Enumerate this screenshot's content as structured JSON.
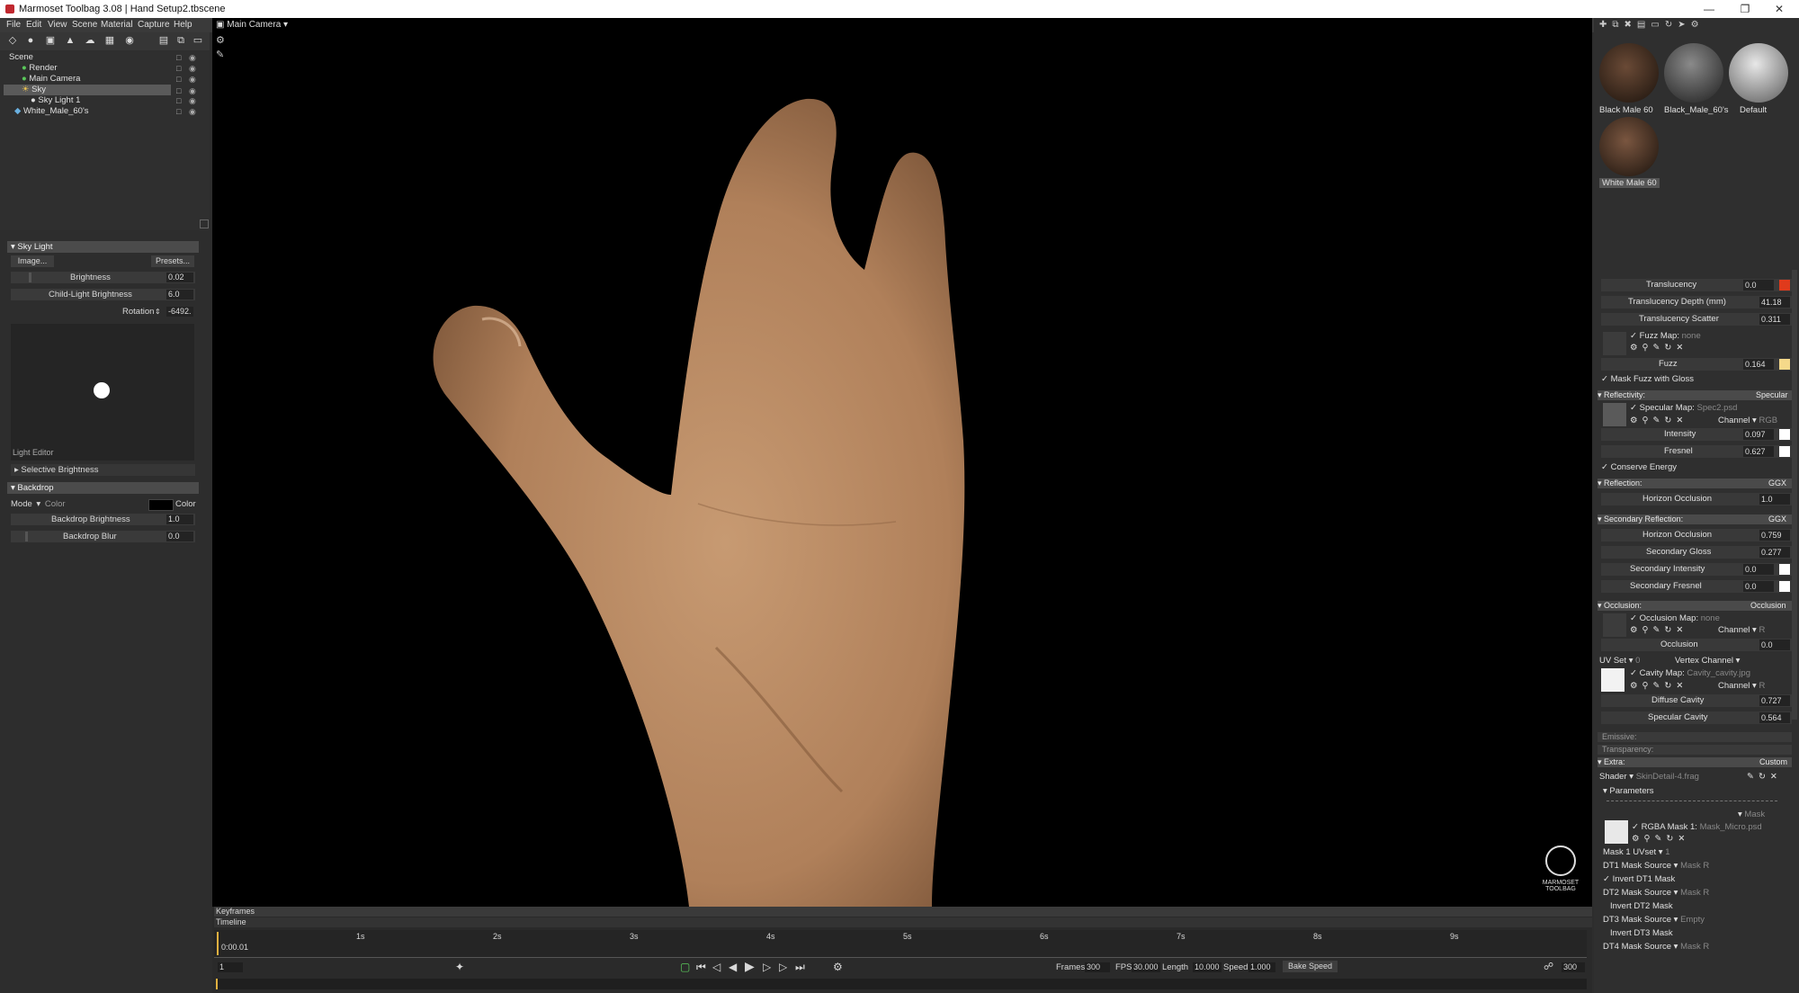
{
  "window": {
    "title": "Marmoset Toolbag 3.08  |  Hand Setup2.tbscene"
  },
  "menu": [
    "File",
    "Edit",
    "View",
    "Scene",
    "Material",
    "Capture",
    "Help"
  ],
  "outliner": {
    "items": [
      {
        "label": "Scene",
        "indent": 0
      },
      {
        "label": "Render",
        "indent": 1
      },
      {
        "label": "Main Camera",
        "indent": 1
      },
      {
        "label": "Sky",
        "indent": 1,
        "selected": true
      },
      {
        "label": "Sky Light 1",
        "indent": 2
      },
      {
        "label": "White_Male_60's",
        "indent": 1
      }
    ]
  },
  "skylight": {
    "header": "Sky Light",
    "image_btn": "Image...",
    "presets_btn": "Presets...",
    "brightness_label": "Brightness",
    "brightness": "0.02",
    "child_label": "Child-Light Brightness",
    "child": "6.0",
    "rotation_label": "Rotation",
    "rotation": "-6492.",
    "light_editor": "Light Editor",
    "selective": "Selective Brightness"
  },
  "backdrop": {
    "header": "Backdrop",
    "mode_label": "Mode",
    "mode_value": "Color",
    "color_label": "Color",
    "brightness_label": "Backdrop Brightness",
    "brightness": "1.0",
    "blur_label": "Backdrop Blur",
    "blur": "0.0"
  },
  "viewport": {
    "camera": "Main Camera",
    "logo": "MARMOSET TOOLBAG"
  },
  "materials": [
    {
      "name": "Black Male 60",
      "selected": false
    },
    {
      "name": "Black_Male_60's",
      "selected": false
    },
    {
      "name": "Default",
      "selected": false
    },
    {
      "name": "White Male 60",
      "selected": true
    }
  ],
  "props": {
    "translucency": {
      "label": "Translucency",
      "value": "0.0",
      "color": "#e03a1c"
    },
    "trans_depth": {
      "label": "Translucency Depth (mm)",
      "value": "41.18"
    },
    "trans_scatter": {
      "label": "Translucency Scatter",
      "value": "0.311"
    },
    "fuzz_map": {
      "label": "Fuzz Map:",
      "value": "none"
    },
    "fuzz": {
      "label": "Fuzz",
      "value": "0.164",
      "color": "#f5d98a"
    },
    "mask_fuzz": "Mask Fuzz with Gloss",
    "reflectivity": {
      "label": "Reflectivity:",
      "mode": "Specular"
    },
    "spec_map": {
      "label": "Specular Map:",
      "value": "Spec2.psd",
      "channel": "Channel",
      "channel_val": "RGB"
    },
    "intensity": {
      "label": "Intensity",
      "value": "0.097"
    },
    "fresnel": {
      "label": "Fresnel",
      "value": "0.627"
    },
    "conserve": "Conserve Energy",
    "reflection": {
      "label": "Reflection:",
      "mode": "GGX"
    },
    "horizon1": {
      "label": "Horizon Occlusion",
      "value": "1.0"
    },
    "sec_reflection": {
      "label": "Secondary Reflection:",
      "mode": "GGX"
    },
    "horizon2": {
      "label": "Horizon Occlusion",
      "value": "0.759"
    },
    "sec_gloss": {
      "label": "Secondary Gloss",
      "value": "0.277"
    },
    "sec_intensity": {
      "label": "Secondary Intensity",
      "value": "0.0"
    },
    "sec_fresnel": {
      "label": "Secondary Fresnel",
      "value": "0.0"
    },
    "occlusion": {
      "label": "Occlusion:",
      "mode": "Occlusion"
    },
    "occ_map": {
      "label": "Occlusion Map:",
      "value": "none",
      "channel": "Channel",
      "channel_val": "R"
    },
    "occ": {
      "label": "Occlusion",
      "value": "0.0"
    },
    "uvset": {
      "label": "UV Set",
      "value": "0",
      "vertex": "Vertex Channel"
    },
    "cavity_map": {
      "label": "Cavity Map:",
      "value": "Cavity_cavity.jpg",
      "channel": "Channel",
      "channel_val": "R"
    },
    "diffuse_cavity": {
      "label": "Diffuse Cavity",
      "value": "0.727"
    },
    "specular_cavity": {
      "label": "Specular Cavity",
      "value": "0.564"
    },
    "emissive": "Emissive:",
    "transparency": "Transparency:",
    "extra": {
      "label": "Extra:",
      "mode": "Custom"
    },
    "shader": {
      "label": "Shader",
      "value": "SkinDetail-4.frag"
    },
    "parameters": "Parameters",
    "mask_sel": "Mask",
    "rgba_mask": {
      "label": "RGBA Mask 1:",
      "value": "Mask_Micro.psd"
    },
    "mask_uv": {
      "label": "Mask 1 UVset",
      "value": "1"
    },
    "dt1": {
      "label": "DT1 Mask Source",
      "value": "Mask R"
    },
    "inv_dt1": "Invert DT1 Mask",
    "dt2": {
      "label": "DT2 Mask Source",
      "value": "Mask R"
    },
    "inv_dt2": "Invert DT2 Mask",
    "dt3": {
      "label": "DT3 Mask Source",
      "value": "Empty"
    },
    "inv_dt3": "Invert DT3 Mask",
    "dt4": {
      "label": "DT4 Mask Source",
      "value": "Mask R"
    }
  },
  "timeline": {
    "keyframes": "Keyframes",
    "timeline": "Timeline",
    "current": "0:00.01",
    "ticks": [
      "1s",
      "2s",
      "3s",
      "4s",
      "5s",
      "6s",
      "7s",
      "8s",
      "9s"
    ],
    "frame": "1",
    "frames_label": "Frames",
    "frames": "300",
    "fps_label": "FPS",
    "fps": "30.000",
    "length_label": "Length",
    "length": "10.000",
    "speed_label": "Speed",
    "speed": "1.000",
    "bake": "Bake Speed",
    "end": "300"
  }
}
